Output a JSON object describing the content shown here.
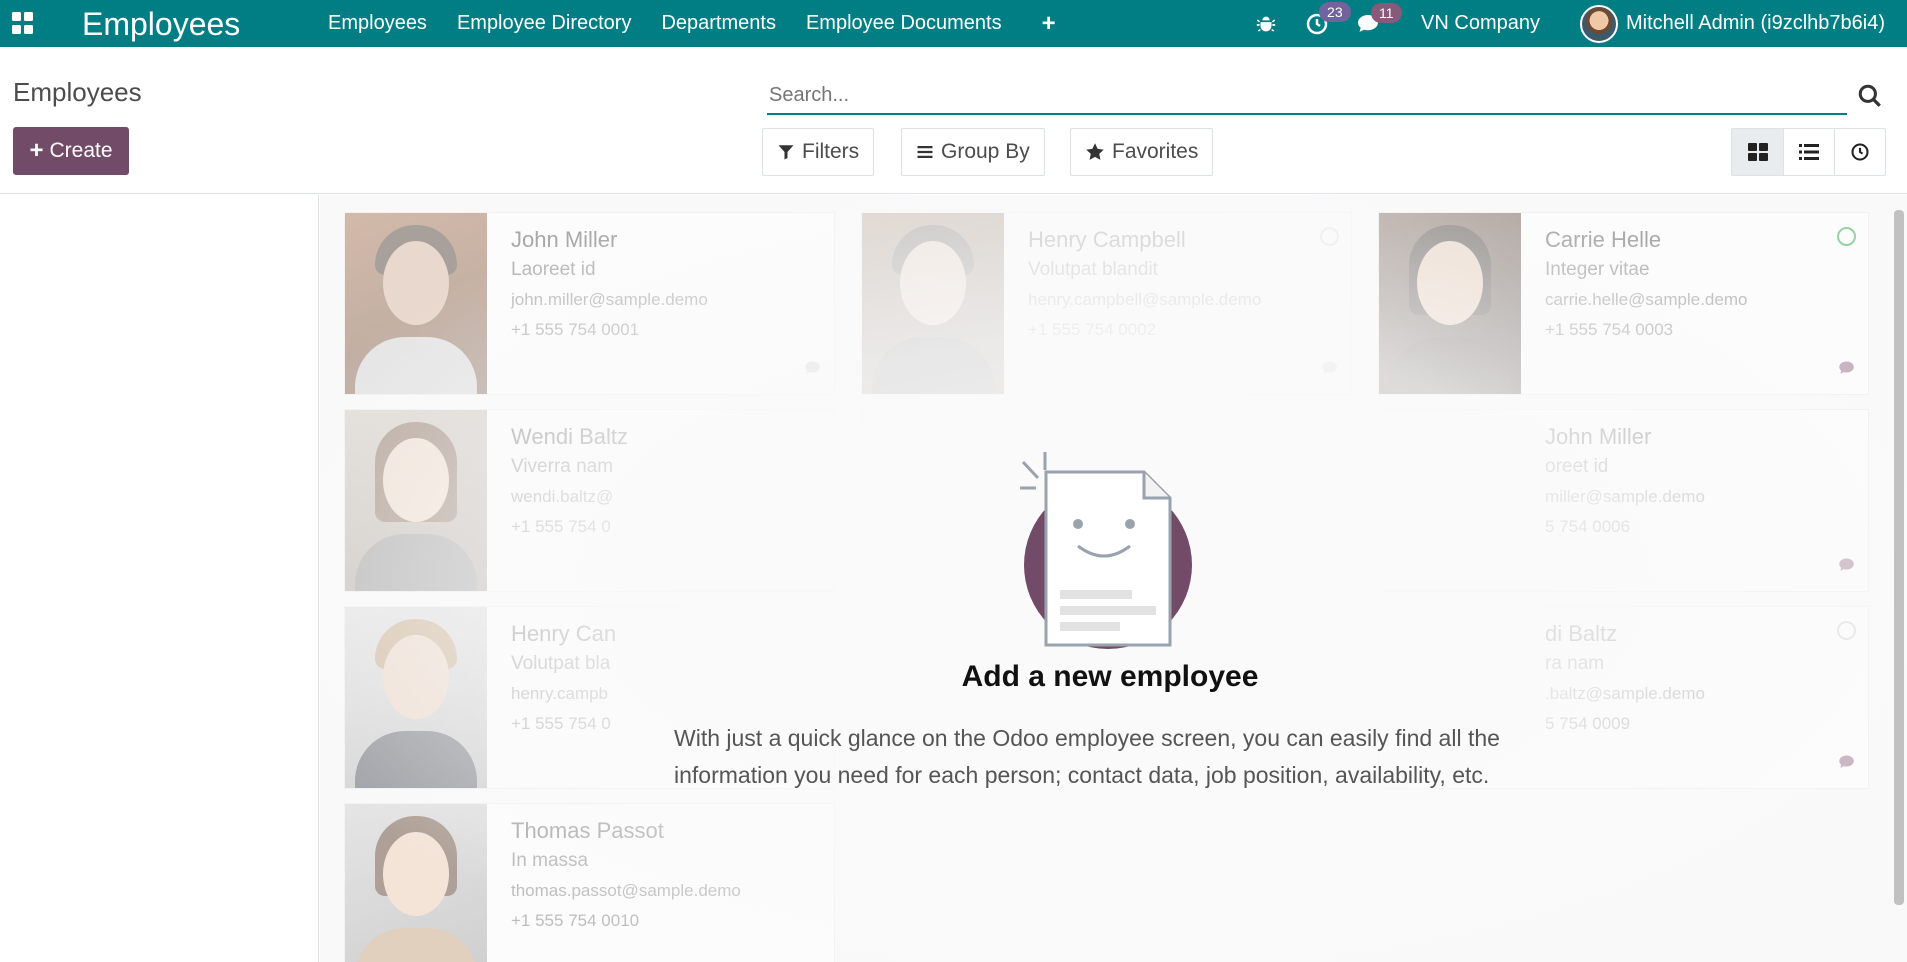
{
  "navbar": {
    "app_title": "Employees",
    "menu": [
      "Employees",
      "Employee Directory",
      "Departments",
      "Employee Documents"
    ],
    "activity_count": "23",
    "messages_count": "11",
    "company": "VN Company",
    "user": "Mitchell Admin (i9zclhb7b6i4)"
  },
  "control_panel": {
    "breadcrumb": "Employees",
    "create_label": "Create",
    "search_placeholder": "Search...",
    "filters_label": "Filters",
    "groupby_label": "Group By",
    "favorites_label": "Favorites"
  },
  "employees": [
    {
      "name": "John Miller",
      "job": "Laoreet id",
      "email": "john.miller@sample.demo",
      "phone": "+1 555 754 0001"
    },
    {
      "name": "Henry Campbell",
      "job": "Volutpat blandit",
      "email": "henry.campbell@sample.demo",
      "phone": "+1 555 754 0002"
    },
    {
      "name": "Carrie Helle",
      "job": "Integer vitae",
      "email": "carrie.helle@sample.demo",
      "phone": "+1 555 754 0003"
    },
    {
      "name": "Wendi Baltz",
      "job": "Viverra nam",
      "email": "wendi.baltz@",
      "phone": "+1 555 754 0"
    },
    {
      "name": "John Miller",
      "job": "oreet id",
      "email": "miller@sample.demo",
      "phone": "5 754 0006"
    },
    {
      "name": "Henry Can",
      "job": "Volutpat bla",
      "email": "henry.campb",
      "phone": "+1 555 754 0"
    },
    {
      "name": "di Baltz",
      "job": "ra nam",
      "email": ".baltz@sample.demo",
      "phone": "5 754 0009"
    },
    {
      "name": "Thomas Passot",
      "job": "In massa",
      "email": "thomas.passot@sample.demo",
      "phone": "+1 555 754 0010"
    }
  ],
  "help": {
    "title": "Add a new employee",
    "text": "With just a quick glance on the Odoo employee screen, you can easily find all the information you need for each person; contact data, job position, availability, etc."
  },
  "colors": {
    "navbar": "#017e84",
    "primary_button": "#714b67",
    "accent": "#875a7b"
  }
}
